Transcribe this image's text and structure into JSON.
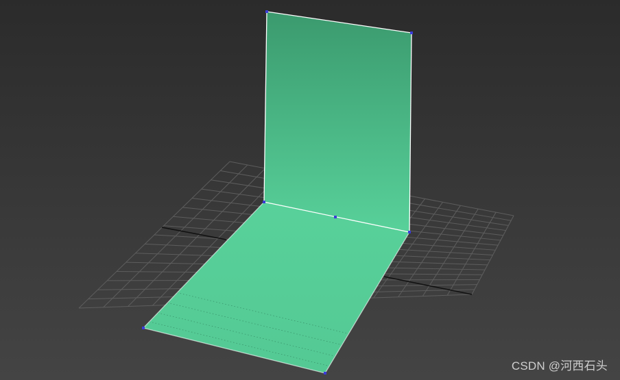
{
  "viewport": {
    "background_top": "#2b2b2b",
    "background_bottom": "#444444",
    "grid_color": "#5e5e5e",
    "axis_color": "#111111",
    "plane_color_top": "#3b9a6e",
    "plane_color_light": "#58d19a",
    "edge_color": "#ffffff",
    "vertex_color": "#3b3bd8"
  },
  "watermark": {
    "text": "CSDN @河西石头"
  }
}
